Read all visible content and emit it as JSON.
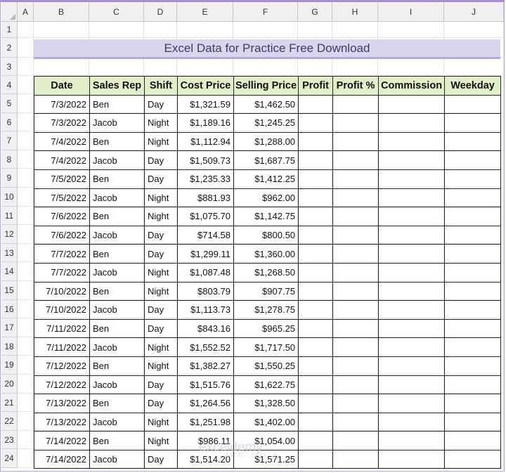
{
  "sheet": {
    "column_headers": [
      "A",
      "B",
      "C",
      "D",
      "E",
      "F",
      "G",
      "H",
      "I",
      "J"
    ],
    "row_numbers": [
      "1",
      "2",
      "3",
      "4",
      "5",
      "6",
      "7",
      "8",
      "9",
      "10",
      "11",
      "12",
      "13",
      "14",
      "15",
      "16",
      "17",
      "18",
      "19",
      "20",
      "21",
      "22",
      "23",
      "24"
    ],
    "title": "Excel Data for Practice Free Download",
    "table_headers": [
      "Date",
      "Sales Rep",
      "Shift",
      "Cost Price",
      "Selling Price",
      "Profit",
      "Profit %",
      "Commission",
      "Weekday"
    ],
    "rows": [
      [
        "7/3/2022",
        "Ben",
        "Day",
        "$1,321.59",
        "$1,462.50",
        "",
        "",
        "",
        ""
      ],
      [
        "7/3/2022",
        "Jacob",
        "Night",
        "$1,189.16",
        "$1,245.25",
        "",
        "",
        "",
        ""
      ],
      [
        "7/4/2022",
        "Ben",
        "Night",
        "$1,112.94",
        "$1,288.00",
        "",
        "",
        "",
        ""
      ],
      [
        "7/4/2022",
        "Jacob",
        "Day",
        "$1,509.73",
        "$1,687.75",
        "",
        "",
        "",
        ""
      ],
      [
        "7/5/2022",
        "Ben",
        "Day",
        "$1,235.33",
        "$1,412.25",
        "",
        "",
        "",
        ""
      ],
      [
        "7/5/2022",
        "Jacob",
        "Night",
        "$881.93",
        "$962.00",
        "",
        "",
        "",
        ""
      ],
      [
        "7/6/2022",
        "Ben",
        "Night",
        "$1,075.70",
        "$1,142.75",
        "",
        "",
        "",
        ""
      ],
      [
        "7/6/2022",
        "Jacob",
        "Day",
        "$714.58",
        "$800.50",
        "",
        "",
        "",
        ""
      ],
      [
        "7/7/2022",
        "Ben",
        "Day",
        "$1,299.11",
        "$1,360.00",
        "",
        "",
        "",
        ""
      ],
      [
        "7/7/2022",
        "Jacob",
        "Night",
        "$1,087.48",
        "$1,268.50",
        "",
        "",
        "",
        ""
      ],
      [
        "7/10/2022",
        "Ben",
        "Night",
        "$803.79",
        "$907.75",
        "",
        "",
        "",
        ""
      ],
      [
        "7/10/2022",
        "Jacob",
        "Day",
        "$1,113.73",
        "$1,278.75",
        "",
        "",
        "",
        ""
      ],
      [
        "7/11/2022",
        "Ben",
        "Day",
        "$843.16",
        "$965.25",
        "",
        "",
        "",
        ""
      ],
      [
        "7/11/2022",
        "Jacob",
        "Night",
        "$1,552.52",
        "$1,717.50",
        "",
        "",
        "",
        ""
      ],
      [
        "7/12/2022",
        "Ben",
        "Night",
        "$1,382.27",
        "$1,550.25",
        "",
        "",
        "",
        ""
      ],
      [
        "7/12/2022",
        "Jacob",
        "Day",
        "$1,515.76",
        "$1,622.75",
        "",
        "",
        "",
        ""
      ],
      [
        "7/13/2022",
        "Ben",
        "Day",
        "$1,264.56",
        "$1,328.50",
        "",
        "",
        "",
        ""
      ],
      [
        "7/13/2022",
        "Jacob",
        "Night",
        "$1,251.98",
        "$1,402.00",
        "",
        "",
        "",
        ""
      ],
      [
        "7/14/2022",
        "Ben",
        "Night",
        "$986.11",
        "$1,054.00",
        "",
        "",
        "",
        ""
      ],
      [
        "7/14/2022",
        "Jacob",
        "Day",
        "$1,514.20",
        "$1,571.25",
        "",
        "",
        "",
        ""
      ]
    ]
  },
  "watermark": {
    "name": "exceldemy",
    "tagline": "EXCEL · DATA · BI"
  },
  "colors": {
    "title_bg": "#d9d5ee",
    "header_bg": "#e2efc9",
    "frame": "#a88fd2"
  }
}
